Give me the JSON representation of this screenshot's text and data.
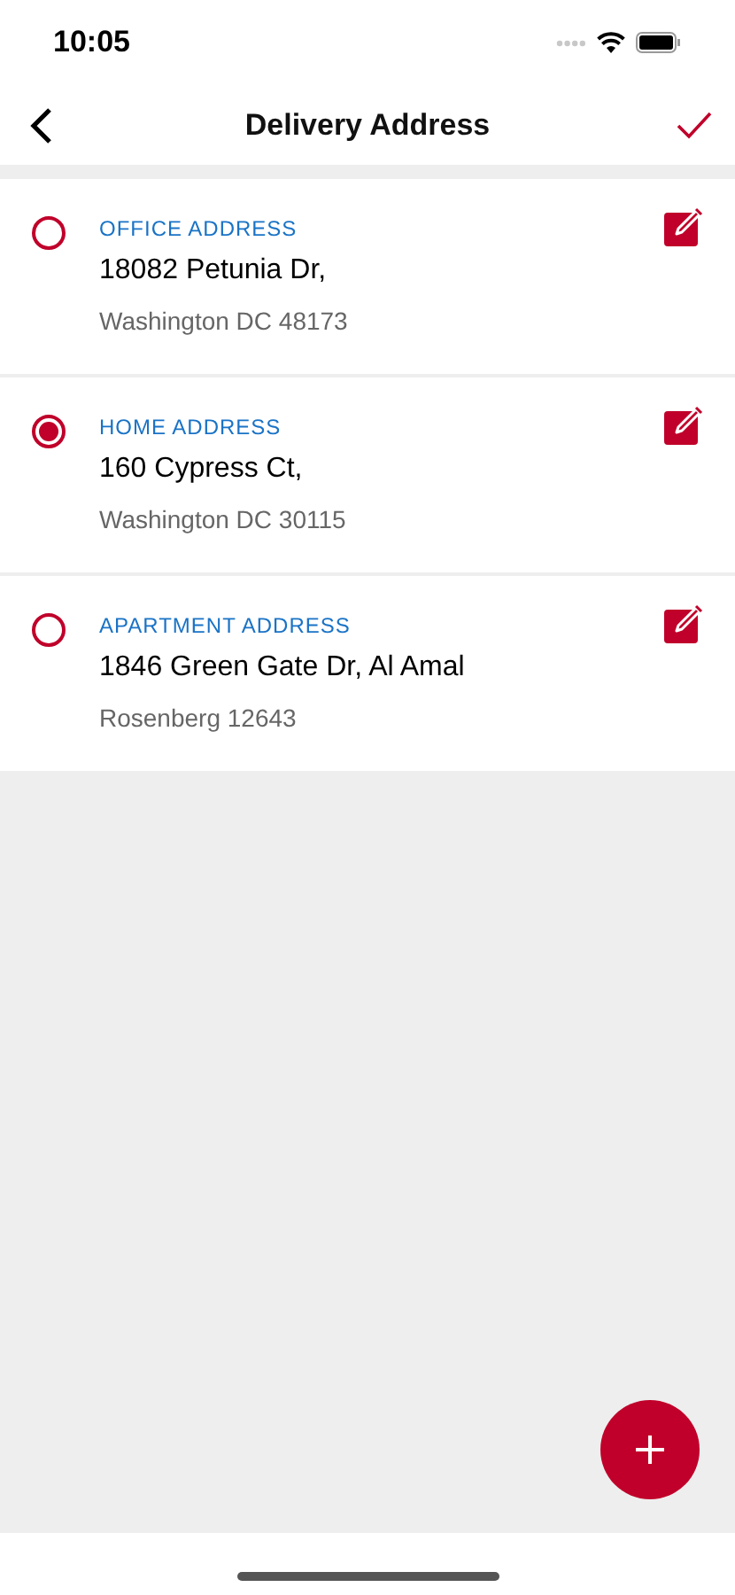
{
  "status_bar": {
    "time": "10:05"
  },
  "nav": {
    "title": "Delivery Address"
  },
  "addresses": [
    {
      "label": "OFFICE ADDRESS",
      "line1": "18082 Petunia Dr,",
      "line2": "Washington DC 48173",
      "selected": false
    },
    {
      "label": "HOME ADDRESS",
      "line1": "160 Cypress Ct,",
      "line2": "Washington DC 30115",
      "selected": true
    },
    {
      "label": "APARTMENT ADDRESS",
      "line1": "1846 Green Gate Dr, Al Amal",
      "line2": "Rosenberg 12643",
      "selected": false
    }
  ]
}
